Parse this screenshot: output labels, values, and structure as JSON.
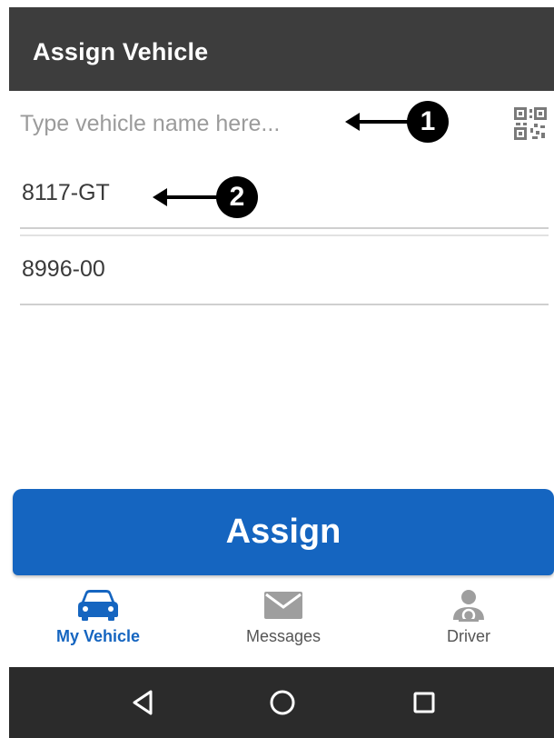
{
  "app_bar": {
    "title": "Assign Vehicle"
  },
  "search": {
    "placeholder": "Type vehicle name here...",
    "value": "",
    "scan_icon": "qr-code-icon"
  },
  "annotations": [
    {
      "number": "1"
    },
    {
      "number": "2"
    }
  ],
  "vehicles": [
    {
      "name": "8117-GT"
    },
    {
      "name": "8996-00"
    }
  ],
  "assign_button": {
    "label": "Assign"
  },
  "bottom_nav": {
    "items": [
      {
        "label": "My Vehicle",
        "icon": "car-icon",
        "active": true
      },
      {
        "label": "Messages",
        "icon": "envelope-icon",
        "active": false
      },
      {
        "label": "Driver",
        "icon": "driver-icon",
        "active": false
      }
    ]
  },
  "colors": {
    "app_bar": "#3d3d3d",
    "accent": "#1565c0",
    "inactive_icon": "#9e9e9e",
    "system_bar": "#2b2b2b"
  },
  "system_nav": {
    "back": "back-triangle-icon",
    "home": "home-circle-icon",
    "recents": "recents-square-icon"
  }
}
